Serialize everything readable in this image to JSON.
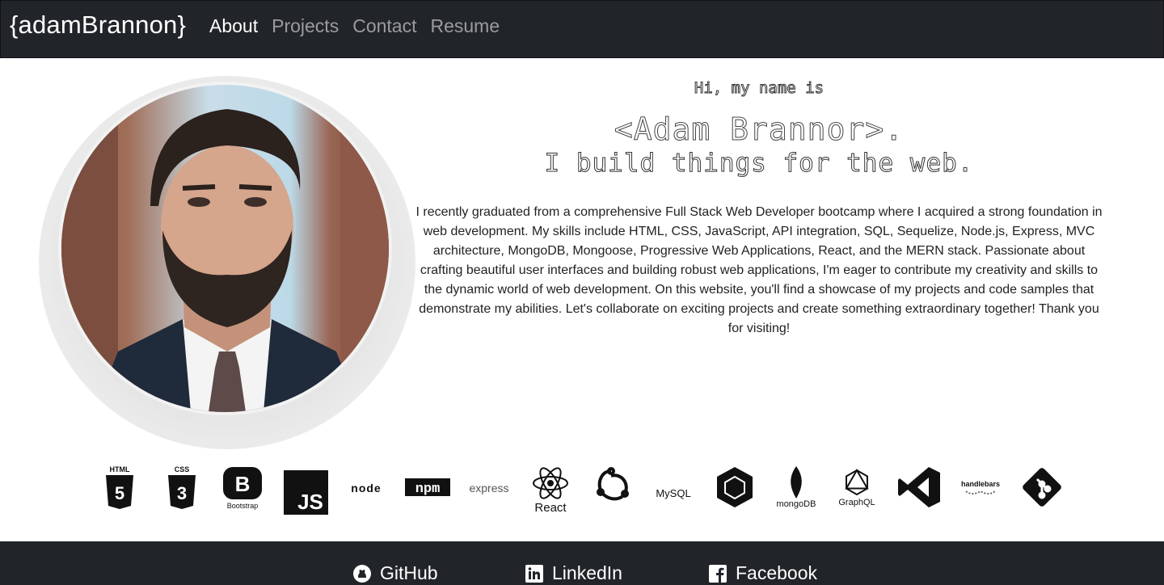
{
  "nav": {
    "brand": "{adamBrannon}",
    "links": [
      {
        "label": "About",
        "active": true
      },
      {
        "label": "Projects",
        "active": false
      },
      {
        "label": "Contact",
        "active": false
      },
      {
        "label": "Resume",
        "active": false
      }
    ]
  },
  "hero": {
    "greeting": "Hi, my name is",
    "name": "<Adam Brannor>.",
    "tagline": "I build things for the web.",
    "bio": "I recently graduated from a comprehensive Full Stack Web Developer bootcamp where I acquired a strong foundation in web development. My skills include HTML, CSS, JavaScript, API integration, SQL, Sequelize, Node.js, Express, MVC architecture, MongoDB, Mongoose, Progressive Web Applications, React, and the MERN stack. Passionate about crafting beautiful user interfaces and building robust web applications, I'm eager to contribute my creativity and skills to the dynamic world of web development. On this website, you'll find a showcase of my projects and code samples that demonstrate my abilities. Let's collaborate on exciting projects and create something extraordinary together! Thank you for visiting!"
  },
  "tech_icons": [
    {
      "name": "html5-icon",
      "label": "HTML"
    },
    {
      "name": "css3-icon",
      "label": "CSS"
    },
    {
      "name": "bootstrap-icon",
      "label": "Bootstrap"
    },
    {
      "name": "javascript-icon",
      "label": "JS"
    },
    {
      "name": "nodejs-icon",
      "label": "node"
    },
    {
      "name": "npm-icon",
      "label": "npm"
    },
    {
      "name": "express-icon",
      "label": "express"
    },
    {
      "name": "react-icon",
      "label": "React"
    },
    {
      "name": "redux-icon",
      "label": ""
    },
    {
      "name": "mysql-icon",
      "label": "MySQL"
    },
    {
      "name": "sequelize-icon",
      "label": ""
    },
    {
      "name": "mongodb-icon",
      "label": "mongoDB"
    },
    {
      "name": "graphql-icon",
      "label": "GraphQL"
    },
    {
      "name": "vscode-icon",
      "label": ""
    },
    {
      "name": "handlebars-icon",
      "label": "handlebars"
    },
    {
      "name": "git-icon",
      "label": ""
    }
  ],
  "footer": {
    "links": [
      {
        "label": "GitHub",
        "icon": "github-icon"
      },
      {
        "label": "LinkedIn",
        "icon": "linkedin-icon"
      },
      {
        "label": "Facebook",
        "icon": "facebook-icon"
      }
    ]
  }
}
